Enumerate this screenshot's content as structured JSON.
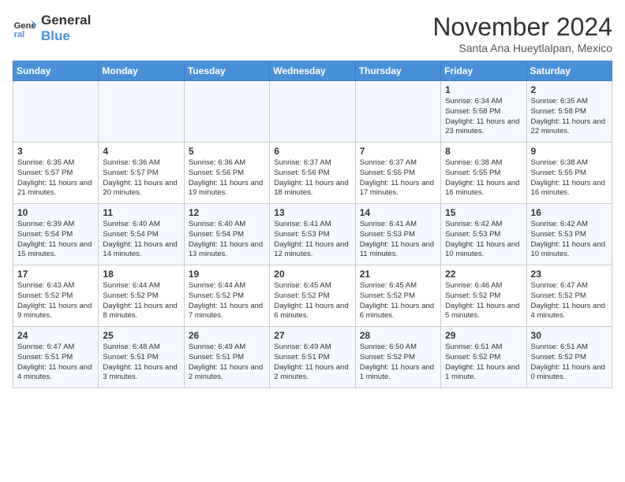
{
  "logo": {
    "line1": "General",
    "line2": "Blue"
  },
  "title": "November 2024",
  "subtitle": "Santa Ana Hueytlalpan, Mexico",
  "headers": [
    "Sunday",
    "Monday",
    "Tuesday",
    "Wednesday",
    "Thursday",
    "Friday",
    "Saturday"
  ],
  "weeks": [
    [
      {
        "day": "",
        "info": ""
      },
      {
        "day": "",
        "info": ""
      },
      {
        "day": "",
        "info": ""
      },
      {
        "day": "",
        "info": ""
      },
      {
        "day": "",
        "info": ""
      },
      {
        "day": "1",
        "info": "Sunrise: 6:34 AM\nSunset: 5:58 PM\nDaylight: 11 hours and 23 minutes."
      },
      {
        "day": "2",
        "info": "Sunrise: 6:35 AM\nSunset: 5:58 PM\nDaylight: 11 hours and 22 minutes."
      }
    ],
    [
      {
        "day": "3",
        "info": "Sunrise: 6:35 AM\nSunset: 5:57 PM\nDaylight: 11 hours and 21 minutes."
      },
      {
        "day": "4",
        "info": "Sunrise: 6:36 AM\nSunset: 5:57 PM\nDaylight: 11 hours and 20 minutes."
      },
      {
        "day": "5",
        "info": "Sunrise: 6:36 AM\nSunset: 5:56 PM\nDaylight: 11 hours and 19 minutes."
      },
      {
        "day": "6",
        "info": "Sunrise: 6:37 AM\nSunset: 5:56 PM\nDaylight: 11 hours and 18 minutes."
      },
      {
        "day": "7",
        "info": "Sunrise: 6:37 AM\nSunset: 5:55 PM\nDaylight: 11 hours and 17 minutes."
      },
      {
        "day": "8",
        "info": "Sunrise: 6:38 AM\nSunset: 5:55 PM\nDaylight: 11 hours and 16 minutes."
      },
      {
        "day": "9",
        "info": "Sunrise: 6:38 AM\nSunset: 5:55 PM\nDaylight: 11 hours and 16 minutes."
      }
    ],
    [
      {
        "day": "10",
        "info": "Sunrise: 6:39 AM\nSunset: 5:54 PM\nDaylight: 11 hours and 15 minutes."
      },
      {
        "day": "11",
        "info": "Sunrise: 6:40 AM\nSunset: 5:54 PM\nDaylight: 11 hours and 14 minutes."
      },
      {
        "day": "12",
        "info": "Sunrise: 6:40 AM\nSunset: 5:54 PM\nDaylight: 11 hours and 13 minutes."
      },
      {
        "day": "13",
        "info": "Sunrise: 6:41 AM\nSunset: 5:53 PM\nDaylight: 11 hours and 12 minutes."
      },
      {
        "day": "14",
        "info": "Sunrise: 6:41 AM\nSunset: 5:53 PM\nDaylight: 11 hours and 11 minutes."
      },
      {
        "day": "15",
        "info": "Sunrise: 6:42 AM\nSunset: 5:53 PM\nDaylight: 11 hours and 10 minutes."
      },
      {
        "day": "16",
        "info": "Sunrise: 6:42 AM\nSunset: 5:53 PM\nDaylight: 11 hours and 10 minutes."
      }
    ],
    [
      {
        "day": "17",
        "info": "Sunrise: 6:43 AM\nSunset: 5:52 PM\nDaylight: 11 hours and 9 minutes."
      },
      {
        "day": "18",
        "info": "Sunrise: 6:44 AM\nSunset: 5:52 PM\nDaylight: 11 hours and 8 minutes."
      },
      {
        "day": "19",
        "info": "Sunrise: 6:44 AM\nSunset: 5:52 PM\nDaylight: 11 hours and 7 minutes."
      },
      {
        "day": "20",
        "info": "Sunrise: 6:45 AM\nSunset: 5:52 PM\nDaylight: 11 hours and 6 minutes."
      },
      {
        "day": "21",
        "info": "Sunrise: 6:45 AM\nSunset: 5:52 PM\nDaylight: 11 hours and 6 minutes."
      },
      {
        "day": "22",
        "info": "Sunrise: 6:46 AM\nSunset: 5:52 PM\nDaylight: 11 hours and 5 minutes."
      },
      {
        "day": "23",
        "info": "Sunrise: 6:47 AM\nSunset: 5:52 PM\nDaylight: 11 hours and 4 minutes."
      }
    ],
    [
      {
        "day": "24",
        "info": "Sunrise: 6:47 AM\nSunset: 5:51 PM\nDaylight: 11 hours and 4 minutes."
      },
      {
        "day": "25",
        "info": "Sunrise: 6:48 AM\nSunset: 5:51 PM\nDaylight: 11 hours and 3 minutes."
      },
      {
        "day": "26",
        "info": "Sunrise: 6:49 AM\nSunset: 5:51 PM\nDaylight: 11 hours and 2 minutes."
      },
      {
        "day": "27",
        "info": "Sunrise: 6:49 AM\nSunset: 5:51 PM\nDaylight: 11 hours and 2 minutes."
      },
      {
        "day": "28",
        "info": "Sunrise: 6:50 AM\nSunset: 5:52 PM\nDaylight: 11 hours and 1 minute."
      },
      {
        "day": "29",
        "info": "Sunrise: 6:51 AM\nSunset: 5:52 PM\nDaylight: 11 hours and 1 minute."
      },
      {
        "day": "30",
        "info": "Sunrise: 6:51 AM\nSunset: 5:52 PM\nDaylight: 11 hours and 0 minutes."
      }
    ]
  ]
}
